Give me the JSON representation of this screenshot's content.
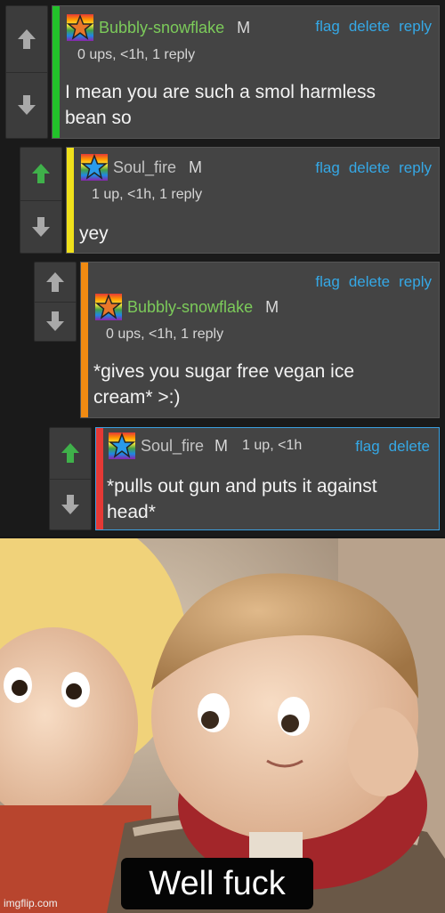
{
  "comments": [
    {
      "username": "Bubbly-snowflake",
      "gender": "M",
      "meta": "0 ups, <1h, 1 reply",
      "text_line1": "I mean you are such a smol harmless",
      "text_line2": "bean so",
      "actions": [
        "flag",
        "delete",
        "reply"
      ],
      "bar_color": "#22c22a",
      "star_color": "#e8772a"
    },
    {
      "username": "Soul_fire",
      "gender": "M",
      "meta": "1 up, <1h, 1 reply",
      "text_line1": "yey",
      "actions": [
        "flag",
        "delete",
        "reply"
      ],
      "bar_color": "#f0e11b",
      "star_color": "#2a9bea"
    },
    {
      "username": "Bubbly-snowflake",
      "gender": "M",
      "meta": "0 ups, <1h, 1 reply",
      "text_line1": "*gives you sugar free vegan ice",
      "text_line2": "cream* >:)",
      "actions": [
        "flag",
        "delete",
        "reply"
      ],
      "bar_color": "#f08a12",
      "star_color": "#e8772a"
    },
    {
      "username": "Soul_fire",
      "gender": "M",
      "meta": "1 up, <1h",
      "text_line1": "*pulls out gun and puts it against",
      "text_line2": "head*",
      "actions": [
        "flag",
        "delete"
      ],
      "bar_color": "#e53935",
      "star_color": "#2a9bea"
    }
  ],
  "meme": {
    "caption": "Well fuck",
    "watermark": "imgflip.com"
  }
}
